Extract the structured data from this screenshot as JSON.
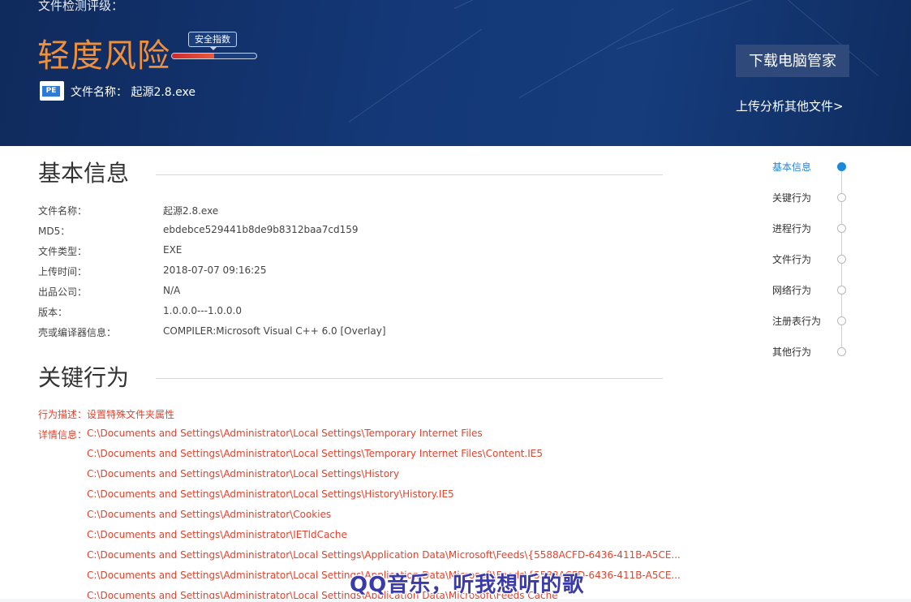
{
  "header": {
    "title": "文件检测评级：",
    "risk_level": "轻度风险",
    "safety_index_label": "安全指数",
    "safety_index_fraction": 0.5,
    "file_icon_label": "PE",
    "file_name_label": "文件名称：",
    "file_name": "起源2.8.exe",
    "download_button": "下载电脑管家",
    "upload_link": "上传分析其他文件>",
    "colors": {
      "banner": "#143878",
      "risk": "#f0903a"
    }
  },
  "basic_info": {
    "title": "基本信息",
    "rows": [
      {
        "key": "文件名称：",
        "value": "起源2.8.exe"
      },
      {
        "key": "MD5：",
        "value": "ebdebce529441b8de9b8312baa7cd159"
      },
      {
        "key": "文件类型：",
        "value": "EXE"
      },
      {
        "key": "上传时间：",
        "value": "2018-07-07 09:16:25"
      },
      {
        "key": "出品公司：",
        "value": "N/A"
      },
      {
        "key": "版本：",
        "value": "1.0.0.0---1.0.0.0"
      },
      {
        "key": "壳或编译器信息：",
        "value": "COMPILER:Microsoft Visual C++ 6.0 [Overlay]"
      }
    ]
  },
  "key_behavior": {
    "title": "关键行为",
    "description": "行为描述：设置特殊文件夹属性",
    "detail_label": "详情信息：",
    "details": [
      "C:\\Documents and Settings\\Administrator\\Local Settings\\Temporary Internet Files",
      "C:\\Documents and Settings\\Administrator\\Local Settings\\Temporary Internet Files\\Content.IE5",
      "C:\\Documents and Settings\\Administrator\\Local Settings\\History",
      "C:\\Documents and Settings\\Administrator\\Local Settings\\History\\History.IE5",
      "C:\\Documents and Settings\\Administrator\\Cookies",
      "C:\\Documents and Settings\\Administrator\\IETldCache",
      "C:\\Documents and Settings\\Administrator\\Local Settings\\Application Data\\Microsoft\\Feeds\\{5588ACFD-6436-411B-A5CE...",
      "C:\\Documents and Settings\\Administrator\\Local Settings\\Application Data\\Microsoft\\Feeds\\{5588ACFD-6436-411B-A5CE...",
      "C:\\Documents and Settings\\Administrator\\Local Settings\\Application Data\\Microsoft\\Feeds Cache"
    ],
    "color": "#e2432d"
  },
  "side_nav": {
    "items": [
      {
        "label": "基本信息",
        "active": true
      },
      {
        "label": "关键行为",
        "active": false
      },
      {
        "label": "进程行为",
        "active": false
      },
      {
        "label": "文件行为",
        "active": false
      },
      {
        "label": "网络行为",
        "active": false
      },
      {
        "label": "注册表行为",
        "active": false
      },
      {
        "label": "其他行为",
        "active": false
      }
    ],
    "active_color": "#2a82d6"
  },
  "watermark": "QQ音乐，听我想听的歌"
}
